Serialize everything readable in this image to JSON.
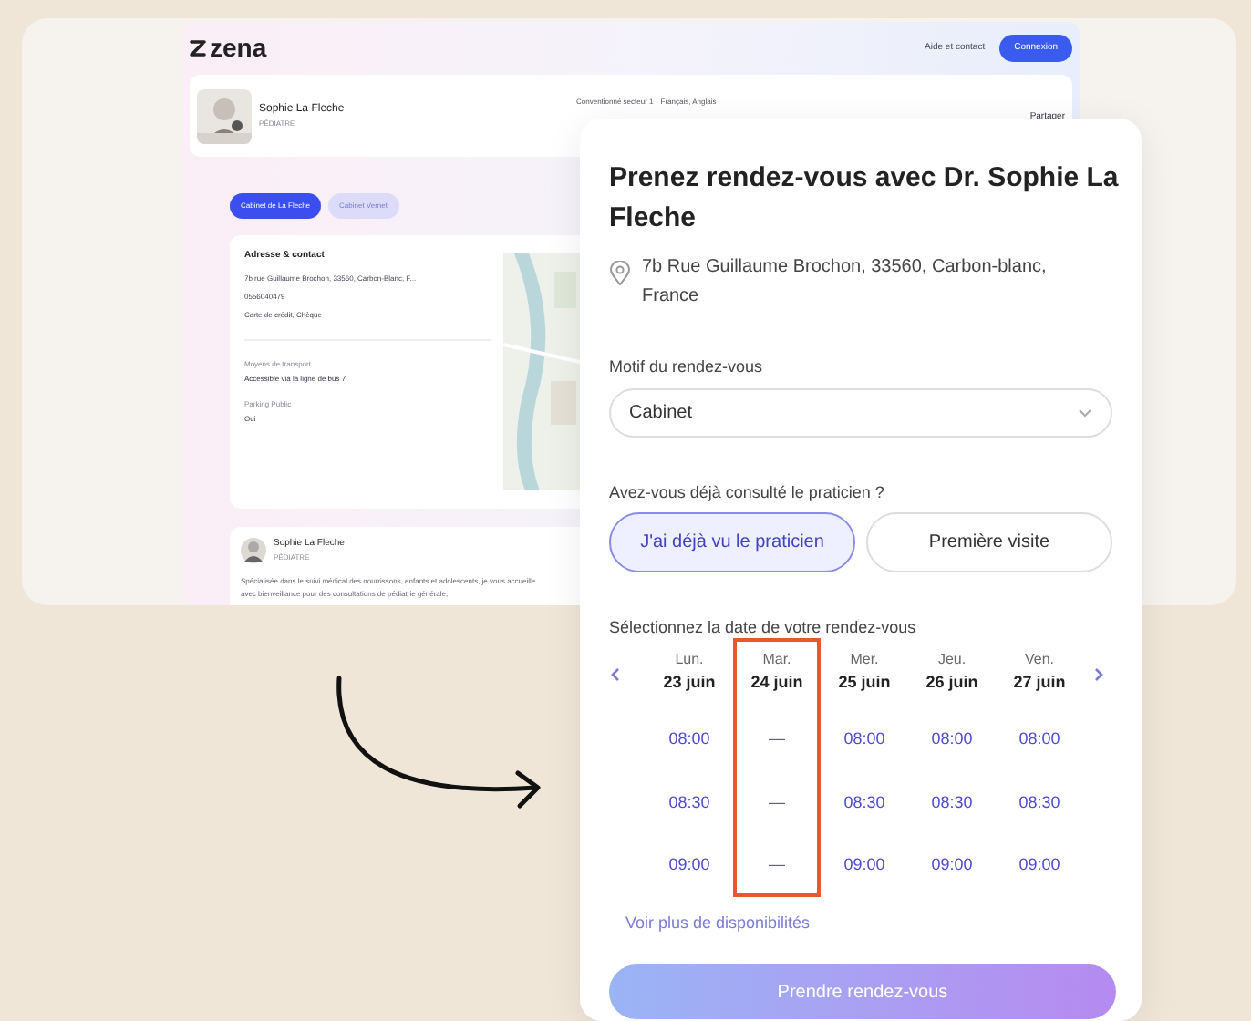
{
  "site": {
    "logo": "zena",
    "help_link": "Aide et contact",
    "login_button": "Connexion",
    "profile": {
      "name": "Sophie La Fleche",
      "specialty": "PÉDIATRE",
      "sector": "Conventionné secteur 1",
      "languages": "Français, Anglais",
      "share": "Partager"
    },
    "tabs": [
      {
        "label": "Cabinet de La Fleche",
        "selected": true
      },
      {
        "label": "Cabinet Vernet",
        "selected": false
      }
    ],
    "contact": {
      "title": "Adresse & contact",
      "address": "7b rue Guillaume Brochon, 33560, Carbon-Blanc, F...",
      "phone": "0556040479",
      "payment": "Carte de crédit, Chèque",
      "transport_label": "Moyens de transport",
      "transport_value": "Accessible via la ligne de bus 7",
      "parking_label": "Parking Public",
      "parking_value": "Oui"
    },
    "bio": {
      "name": "Sophie La Fleche",
      "specialty": "PÉDIATRE",
      "text": "Spécialisée dans le suivi médical des nourrissons, enfants et adolescents, je vous accueille avec bienveillance pour des consultations de pédiatrie générale,"
    }
  },
  "booking": {
    "title": "Prenez rendez-vous avec Dr. Sophie La Fleche",
    "address": "7b Rue Guillaume Brochon, 33560, Carbon-blanc, France",
    "reason_label": "Motif du rendez-vous",
    "reason_value": "Cabinet",
    "question": "Avez-vous déjà consulté le praticien ?",
    "choices": [
      {
        "label": "J'ai déjà vu le praticien",
        "selected": true
      },
      {
        "label": "Première visite",
        "selected": false
      }
    ],
    "date_label": "Sélectionnez la date de votre rendez-vous",
    "days": [
      {
        "day": "Lun.",
        "date": "23 juin",
        "highlighted": false,
        "slots": [
          {
            "text": "08:00",
            "available": true
          },
          {
            "text": "08:30",
            "available": true
          },
          {
            "text": "09:00",
            "available": true
          }
        ]
      },
      {
        "day": "Mar.",
        "date": "24 juin",
        "highlighted": true,
        "slots": [
          {
            "text": "—",
            "available": false
          },
          {
            "text": "—",
            "available": false
          },
          {
            "text": "—",
            "available": false
          }
        ]
      },
      {
        "day": "Mer.",
        "date": "25 juin",
        "highlighted": false,
        "slots": [
          {
            "text": "08:00",
            "available": true
          },
          {
            "text": "08:30",
            "available": true
          },
          {
            "text": "09:00",
            "available": true
          }
        ]
      },
      {
        "day": "Jeu.",
        "date": "26 juin",
        "highlighted": false,
        "slots": [
          {
            "text": "08:00",
            "available": true
          },
          {
            "text": "08:30",
            "available": true
          },
          {
            "text": "09:00",
            "available": true
          }
        ]
      },
      {
        "day": "Ven.",
        "date": "27 juin",
        "highlighted": false,
        "slots": [
          {
            "text": "08:00",
            "available": true
          },
          {
            "text": "08:30",
            "available": true
          },
          {
            "text": "09:00",
            "available": true
          }
        ]
      }
    ],
    "more_link": "Voir plus de disponibilités",
    "submit": "Prendre rendez-vous"
  }
}
